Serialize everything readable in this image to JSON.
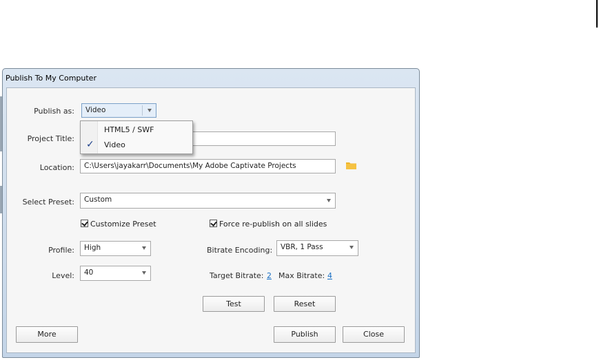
{
  "window": {
    "title": "Publish To My Computer"
  },
  "publish_as": {
    "label": "Publish as:",
    "value": "Video",
    "options": [
      {
        "label": "HTML5 / SWF",
        "selected": false
      },
      {
        "label": "Video",
        "selected": true
      }
    ]
  },
  "project_title": {
    "label": "Project Title:",
    "value": ""
  },
  "location": {
    "label": "Location:",
    "value": "C:\\Users\\jayakarr\\Documents\\My Adobe Captivate Projects",
    "icon": "folder-icon"
  },
  "preset": {
    "label": "Select Preset:",
    "value": "Custom"
  },
  "customize_preset": {
    "label": "Customize Preset",
    "checked": true
  },
  "force_republish": {
    "label": "Force re-publish on all slides",
    "checked": true
  },
  "profile": {
    "label": "Profile:",
    "value": "High"
  },
  "level": {
    "label": "Level:",
    "value": "40"
  },
  "bitrate_encoding": {
    "label": "Bitrate Encoding:",
    "value": "VBR, 1 Pass"
  },
  "target_bitrate": {
    "label": "Target Bitrate:",
    "value": "2"
  },
  "max_bitrate": {
    "label": "Max Bitrate:",
    "value": "4"
  },
  "buttons": {
    "test": "Test",
    "reset": "Reset",
    "more": "More",
    "publish": "Publish",
    "close": "Close"
  },
  "colors": {
    "link": "#1a6fc4",
    "folder": "#f0b429",
    "check": "#1b3f8a"
  }
}
